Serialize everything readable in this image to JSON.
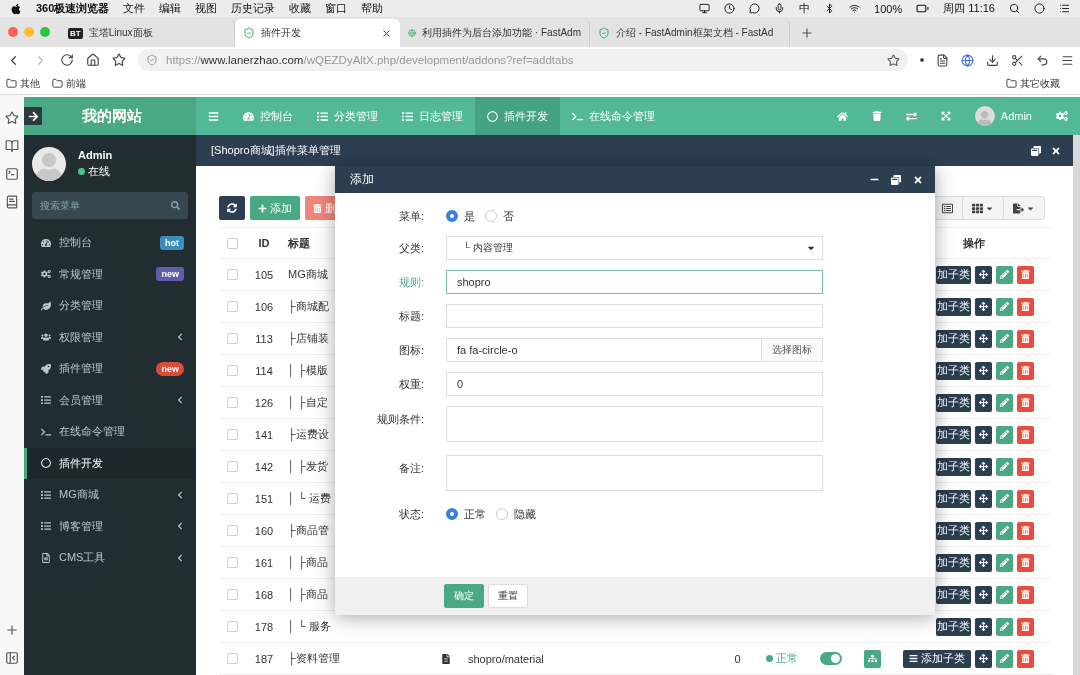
{
  "menubar": {
    "app": "360极速浏览器",
    "menus": [
      "文件",
      "编辑",
      "视图",
      "历史记录",
      "收藏",
      "窗口",
      "帮助"
    ],
    "input_method": "中",
    "battery": "100%",
    "clock": "周四 11:16"
  },
  "browser_tabs": [
    {
      "title": "宝塔Linux面板",
      "badge": "BT",
      "selected": false
    },
    {
      "title": "插件开发",
      "selected": true
    },
    {
      "title": "利用插件为后台添加功能 · FastAdm",
      "selected": false
    },
    {
      "title": "介绍 - FastAdmin框架文档 - FastAd",
      "selected": false
    }
  ],
  "address": {
    "scheme": "https://",
    "host": "www.lanerzhao.com",
    "path": "/wQEZDyAltX.php/development/addons?ref=addtabs"
  },
  "bookmarks": [
    "其他",
    "前端"
  ],
  "other_bookmarks": "其它收藏",
  "app": {
    "logo": "我的网站",
    "user": {
      "name": "Admin",
      "status": "在线"
    },
    "search_placeholder": "搜索菜单",
    "sidebar": [
      {
        "label": "控制台",
        "badge": "hot",
        "color": "#3c8dbc",
        "submenu": false,
        "selected": false
      },
      {
        "label": "常规管理",
        "badge": "new",
        "color": "#605ca8",
        "submenu": false,
        "selected": false
      },
      {
        "label": "分类管理",
        "submenu": false,
        "selected": false
      },
      {
        "label": "权限管理",
        "submenu": true,
        "selected": false
      },
      {
        "label": "插件管理",
        "badge": "new",
        "color": "#dd4b39",
        "submenu": false,
        "selected": false
      },
      {
        "label": "会员管理",
        "submenu": true,
        "selected": false
      },
      {
        "label": "在线命令管理",
        "submenu": false,
        "selected": false
      },
      {
        "label": "插件开发",
        "submenu": false,
        "selected": true
      },
      {
        "label": "MG商城",
        "submenu": true,
        "selected": false
      },
      {
        "label": "博客管理",
        "submenu": true,
        "selected": false
      },
      {
        "label": "CMS工具",
        "submenu": true,
        "selected": false
      }
    ],
    "topnav": [
      {
        "label": "控制台",
        "selected": false
      },
      {
        "label": "分类管理",
        "selected": false
      },
      {
        "label": "日志管理",
        "selected": false
      },
      {
        "label": "插件开发",
        "selected": true
      },
      {
        "label": "在线命令管理",
        "selected": false
      }
    ],
    "admin_name": "Admin",
    "page_tab": "[Shopro商城]插件菜单管理",
    "toolbar": {
      "add": "添加",
      "delete": "删"
    },
    "table": {
      "id_column": "ID",
      "title_column": "标题",
      "actions_column": "操作",
      "header_checked": false,
      "rows": [
        {
          "kind": "covered",
          "id": "105",
          "title": "MG商城",
          "checked": false,
          "add_child": "加子类"
        },
        {
          "kind": "covered",
          "id": "106",
          "title": "├商城配",
          "checked": false,
          "add_child": "加子类"
        },
        {
          "kind": "covered",
          "id": "113",
          "title": "├店铺装",
          "checked": false,
          "add_child": "加子类"
        },
        {
          "kind": "covered",
          "id": "114",
          "title": "│ ├模版",
          "checked": false,
          "add_child": "加子类"
        },
        {
          "kind": "covered",
          "id": "126",
          "title": "│ ├自定",
          "checked": false,
          "add_child": "加子类"
        },
        {
          "kind": "covered",
          "id": "141",
          "title": "├运费设",
          "checked": false,
          "add_child": "加子类"
        },
        {
          "kind": "covered",
          "id": "142",
          "title": "│ ├发货",
          "checked": false,
          "add_child": "加子类"
        },
        {
          "kind": "covered",
          "id": "151",
          "title": "│ └ 运费",
          "checked": false,
          "add_child": "加子类"
        },
        {
          "kind": "covered",
          "id": "160",
          "title": "├商品管",
          "checked": false,
          "add_child": "加子类"
        },
        {
          "kind": "covered",
          "id": "161",
          "title": "│ ├商品",
          "checked": false,
          "add_child": "加子类"
        },
        {
          "kind": "covered",
          "id": "168",
          "title": "│ ├商品",
          "checked": false,
          "add_child": "加子类"
        },
        {
          "kind": "covered",
          "id": "178",
          "title": "│ └ 服务",
          "checked": false,
          "add_child": "加子类"
        },
        {
          "kind": "full",
          "id": "187",
          "title": "├资料管理",
          "checked": false,
          "name": "shopro/material",
          "weight": "0",
          "status": "正常",
          "switch_on": true,
          "add_child": "添加子类"
        }
      ]
    },
    "modal": {
      "title": "添加",
      "fields": [
        {
          "label": "菜单:",
          "kind": "radio",
          "focused": false,
          "options": [
            {
              "label": "是",
              "selected": true
            },
            {
              "label": "否",
              "selected": false
            }
          ]
        },
        {
          "label": "父类:",
          "kind": "select",
          "focused": false,
          "value": "└ 内容管理"
        },
        {
          "label": "规则:",
          "kind": "input",
          "focused": true,
          "value": "shopro"
        },
        {
          "label": "标题:",
          "kind": "input",
          "focused": false
        },
        {
          "label": "图标:",
          "kind": "addon",
          "focused": false,
          "value": "fa fa-circle-o",
          "addon": "选择图标"
        },
        {
          "label": "权重:",
          "kind": "input",
          "focused": false,
          "value": "0"
        },
        {
          "label": "规则条件:",
          "kind": "textarea",
          "focused": false
        },
        {
          "label": "备注:",
          "kind": "textarea",
          "focused": false
        },
        {
          "label": "状态:",
          "kind": "radio",
          "focused": false,
          "options": [
            {
              "label": "正常",
              "selected": true
            },
            {
              "label": "隐藏",
              "selected": false
            }
          ]
        }
      ],
      "buttons": [
        {
          "label": "确定",
          "primary": true
        },
        {
          "label": "重置",
          "primary": false
        }
      ]
    }
  }
}
